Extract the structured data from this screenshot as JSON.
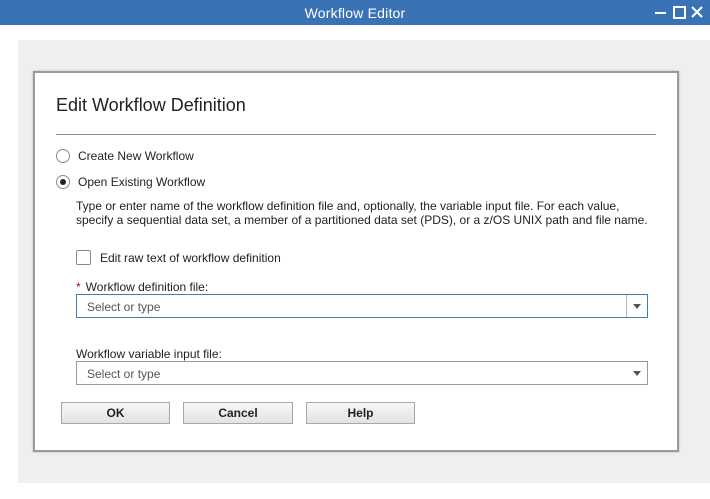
{
  "window": {
    "title": "Workflow Editor"
  },
  "dialog": {
    "title": "Edit Workflow Definition",
    "options": {
      "create_new": {
        "label": "Create New Workflow",
        "checked": false
      },
      "open_existing": {
        "label": "Open Existing Workflow",
        "checked": true
      }
    },
    "description": "Type or enter name of the workflow definition file and, optionally, the variable input file. For each value, specify a sequential data set, a member of a partitioned data set (PDS), or a z/OS UNIX path and file name.",
    "edit_raw": {
      "label": "Edit raw text of workflow definition",
      "checked": false
    },
    "definition_file": {
      "required_marker": "*",
      "label": "Workflow definition file:",
      "placeholder": "Select or type"
    },
    "variable_file": {
      "label": "Workflow variable input file:",
      "placeholder": "Select or type"
    },
    "buttons": {
      "ok": "OK",
      "cancel": "Cancel",
      "help": "Help"
    }
  },
  "colors": {
    "titlebar": "#3a73b5",
    "focus_border": "#3a7fbd",
    "required": "#c00000"
  }
}
